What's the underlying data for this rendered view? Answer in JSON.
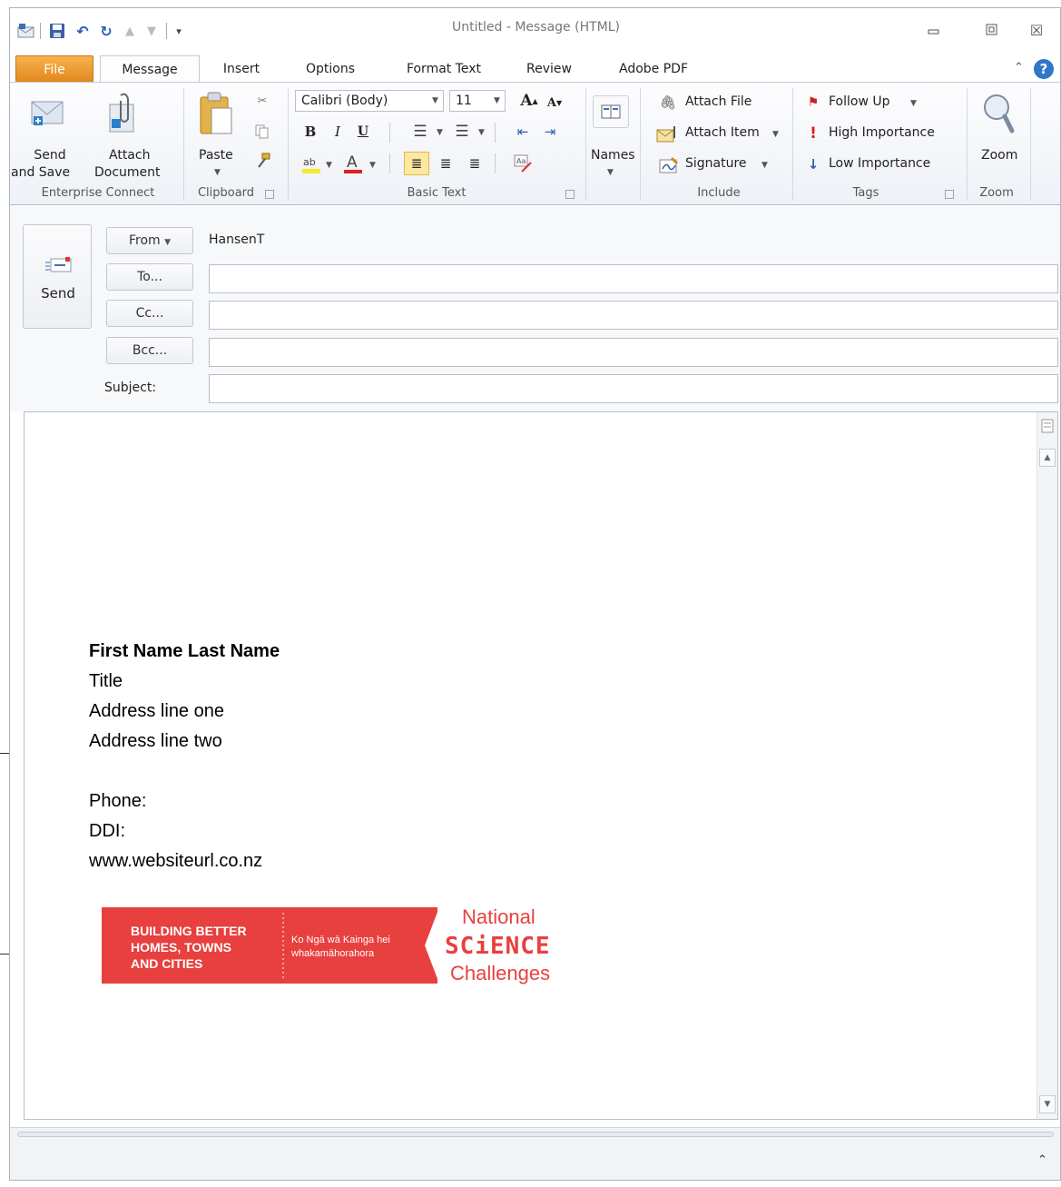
{
  "window": {
    "title": "Untitled - Message (HTML)"
  },
  "tabs": [
    {
      "label": "File"
    },
    {
      "label": "Message"
    },
    {
      "label": "Insert"
    },
    {
      "label": "Options"
    },
    {
      "label": "Format Text"
    },
    {
      "label": "Review"
    },
    {
      "label": "Adobe PDF"
    }
  ],
  "ribbon": {
    "send_save": {
      "line1": "Send",
      "line2": "and Save"
    },
    "attach_doc": {
      "line1": "Attach",
      "line2": "Document"
    },
    "paste_label": "Paste",
    "font_name": "Calibri (Body)",
    "font_size": "11",
    "names_label": "Names",
    "attach_file": "Attach File",
    "attach_item": "Attach Item",
    "signature": "Signature",
    "follow_up": "Follow Up",
    "high_importance": "High Importance",
    "low_importance": "Low Importance",
    "zoom_label": "Zoom",
    "groups": {
      "enterprise": "Enterprise Connect",
      "clipboard": "Clipboard",
      "basic_text": "Basic Text",
      "include": "Include",
      "tags": "Tags",
      "zoom": "Zoom"
    }
  },
  "header": {
    "send_label": "Send",
    "from_label": "From",
    "from_value": "HansenT",
    "to_label": "To...",
    "cc_label": "Cc...",
    "bcc_label": "Bcc...",
    "subject_label": "Subject:",
    "to_value": "",
    "cc_value": "",
    "bcc_value": "",
    "subject_value": ""
  },
  "signature": {
    "name": "First Name Last Name",
    "title": "Title",
    "address1": "Address line one",
    "address2": "Address line two",
    "phone": "Phone:",
    "ddi": "DDI:",
    "website": "www.websiteurl.co.nz"
  },
  "banner": {
    "line1": "BUILDING BETTER",
    "line2": "HOMES, TOWNS",
    "line3": "AND CITIES",
    "maori1": "Ko Ngā wā Kainga hei",
    "maori2": "whakamāhorahora",
    "national": "National",
    "science": "SCiENCE",
    "challenges": "Challenges"
  },
  "colors": {
    "brand_red": "#e8403f",
    "file_tab": "#e8891c"
  }
}
